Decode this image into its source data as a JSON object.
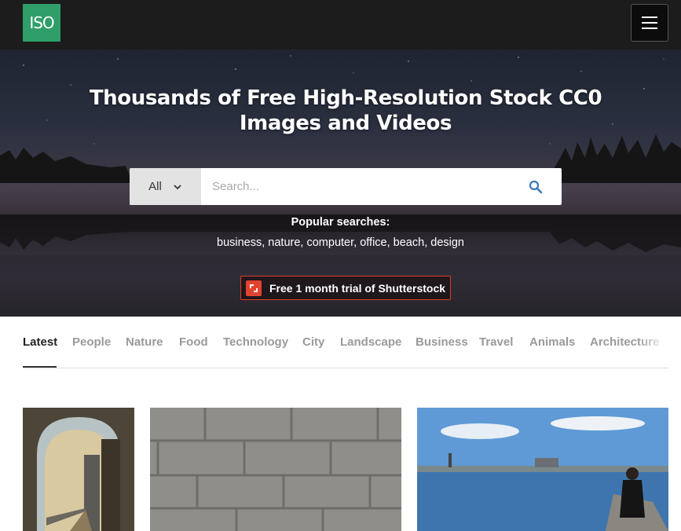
{
  "nav": {
    "logo_text": "ISO",
    "logo_color": "#2f9e69",
    "menu_icon": "hamburger-icon"
  },
  "hero": {
    "title": "Thousands of Free High-Resolution Stock CC0 Images and Videos",
    "search": {
      "category": "All",
      "placeholder": "Search...",
      "value": "",
      "search_icon": "search-icon"
    },
    "popular_label": "Popular searches:",
    "popular_searches": [
      "business",
      "nature",
      "computer",
      "office",
      "beach",
      "design"
    ],
    "promo": {
      "label": "Free 1 month trial of Shutterstock",
      "accent": "#e03a2c"
    }
  },
  "tabs": [
    {
      "label": "Latest",
      "active": true
    },
    {
      "label": "People"
    },
    {
      "label": "Nature"
    },
    {
      "label": "Food"
    },
    {
      "label": "Technology"
    },
    {
      "label": "City"
    },
    {
      "label": "Landscape"
    },
    {
      "label": "Business"
    },
    {
      "label": "Travel"
    },
    {
      "label": "Animals"
    },
    {
      "label": "Architecture"
    }
  ],
  "photos": [
    {
      "subject": "bridge walkway through stone arch"
    },
    {
      "subject": "granite block wall"
    },
    {
      "subject": "woman on pier by harbor"
    }
  ]
}
